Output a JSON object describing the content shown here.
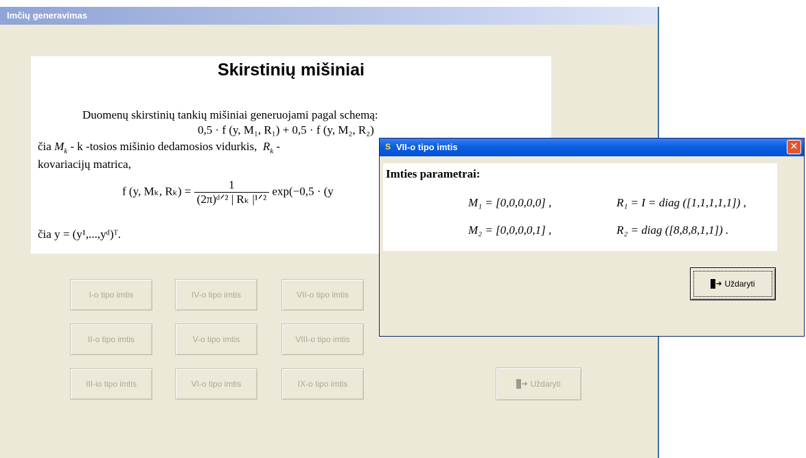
{
  "main_window": {
    "title": "Imčių generavimas",
    "description": {
      "heading": "Skirstinių mišiniai",
      "line1": "Duomenų skirstinių tankių mišiniai generuojami pagal schemą:",
      "formula_mixture": "0,5 · f (y, M₁, R₁) + 0,5 · f (y, M₂, R₂)",
      "line3_prefix": "čia",
      "line3_mid": "- k -tosios mišinio dedamosios vidurkis,",
      "line4": "kovariacijų matrica,",
      "density_lhs": "f (y, Mₖ, Rₖ) =",
      "density_num": "1",
      "density_den": "(2π)ᵈᐟ² | Rₖ |¹ᐟ²",
      "density_rhs": "exp(−0,5 · (y",
      "line6": "čia  y = (y¹,...,yᵈ)ᵀ."
    },
    "buttons": [
      {
        "label": "I-o tipo imtis"
      },
      {
        "label": "IV-o tipo imtis"
      },
      {
        "label": "VII-o tipo imtis"
      },
      {
        "label": "II-o tipo imtis"
      },
      {
        "label": "V-o tipo imtis"
      },
      {
        "label": "VIII-o tipo imtis"
      },
      {
        "label": "III-io tipo imtis"
      },
      {
        "label": "VI-o tipo imtis"
      },
      {
        "label": "IX-o tipo imtis"
      }
    ],
    "close_label": "Uždaryti"
  },
  "dialog": {
    "title": "VII-o tipo imtis",
    "icon": "app-s-icon",
    "close_glyph": "✕",
    "params_heading": "Imties parametrai:",
    "m1": "M₁ = [0,0,0,0,0] ,",
    "r1": "R₁ = I = diag ([1,1,1,1,1]) ,",
    "m2": "M₂ = [0,0,0,0,1] ,",
    "r2": "R₂ = diag ([8,8,8,1,1]) .",
    "close_label": "Uždaryti"
  }
}
